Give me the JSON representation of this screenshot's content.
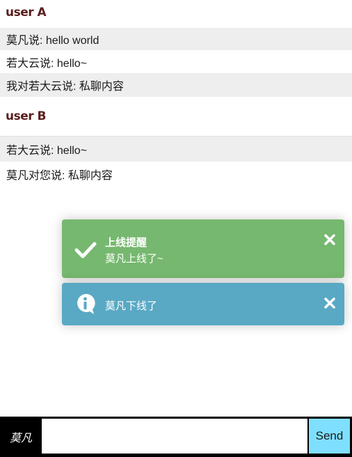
{
  "sections": [
    {
      "heading": "user A",
      "messages": [
        "莫凡说: hello world",
        "若大云说: hello~",
        "我对若大云说: 私聊内容"
      ]
    },
    {
      "heading": "user B",
      "messages": [
        "若大云说: hello~",
        "莫凡对您说: 私聊内容"
      ]
    }
  ],
  "toasts": [
    {
      "type": "success",
      "icon": "checkmark-icon",
      "color": "#76b86f",
      "title": "上线提醒",
      "message": "莫凡上线了~"
    },
    {
      "type": "info",
      "icon": "info-icon",
      "color": "#59a9c4",
      "title": "",
      "message": "莫凡下线了"
    }
  ],
  "composer": {
    "sender": "莫凡",
    "input_value": "",
    "send_label": "Send",
    "send_color": "#7fdfff"
  }
}
